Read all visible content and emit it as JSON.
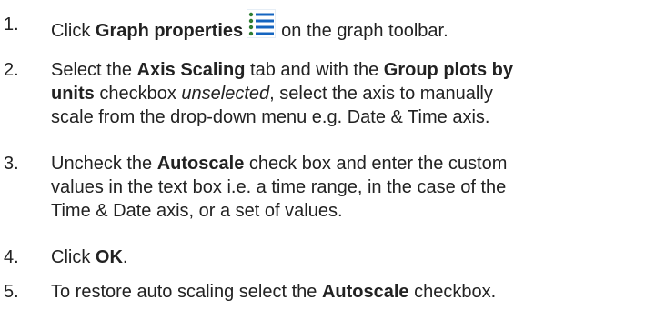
{
  "steps": [
    {
      "number": "1.",
      "lines": [
        [
          {
            "t": "Click ",
            "s": "n"
          },
          {
            "t": "Graph properties",
            "s": "b"
          },
          {
            "icon": "graph-properties-icon"
          },
          {
            "t": "on the graph toolbar.",
            "s": "n"
          }
        ]
      ]
    },
    {
      "number": "2.",
      "lines": [
        [
          {
            "t": "Select the ",
            "s": "n"
          },
          {
            "t": "Axis Scaling",
            "s": "b"
          },
          {
            "t": " tab and with the ",
            "s": "n"
          },
          {
            "t": "Group plots by",
            "s": "b"
          }
        ],
        [
          {
            "t": "units",
            "s": "b"
          },
          {
            "t": " checkbox ",
            "s": "n"
          },
          {
            "t": "unselected",
            "s": "i"
          },
          {
            "t": ", select the axis to manually",
            "s": "n"
          }
        ],
        [
          {
            "t": "scale from the drop-down menu e.g. Date & Time axis.",
            "s": "n"
          }
        ]
      ]
    },
    {
      "number": "3.",
      "lines": [
        [
          {
            "t": "Uncheck the ",
            "s": "n"
          },
          {
            "t": "Autoscale",
            "s": "b"
          },
          {
            "t": " check box and enter the custom",
            "s": "n"
          }
        ],
        [
          {
            "t": "values in the text box i.e. a time range, in the case of the",
            "s": "n"
          }
        ],
        [
          {
            "t": "Time & Date axis, or a set of values.",
            "s": "n"
          }
        ]
      ]
    },
    {
      "number": "4.",
      "lines": [
        [
          {
            "t": "Click ",
            "s": "n"
          },
          {
            "t": "OK",
            "s": "b"
          },
          {
            "t": ".",
            "s": "n"
          }
        ]
      ]
    },
    {
      "number": "5.",
      "lines": [
        [
          {
            "t": "To restore auto scaling select the ",
            "s": "n"
          },
          {
            "t": "Autoscale",
            "s": "b"
          },
          {
            "t": " checkbox.",
            "s": "n"
          }
        ]
      ]
    }
  ],
  "icon_colors": {
    "bullet": "#2e7d32",
    "list_line": "#1565c0"
  }
}
